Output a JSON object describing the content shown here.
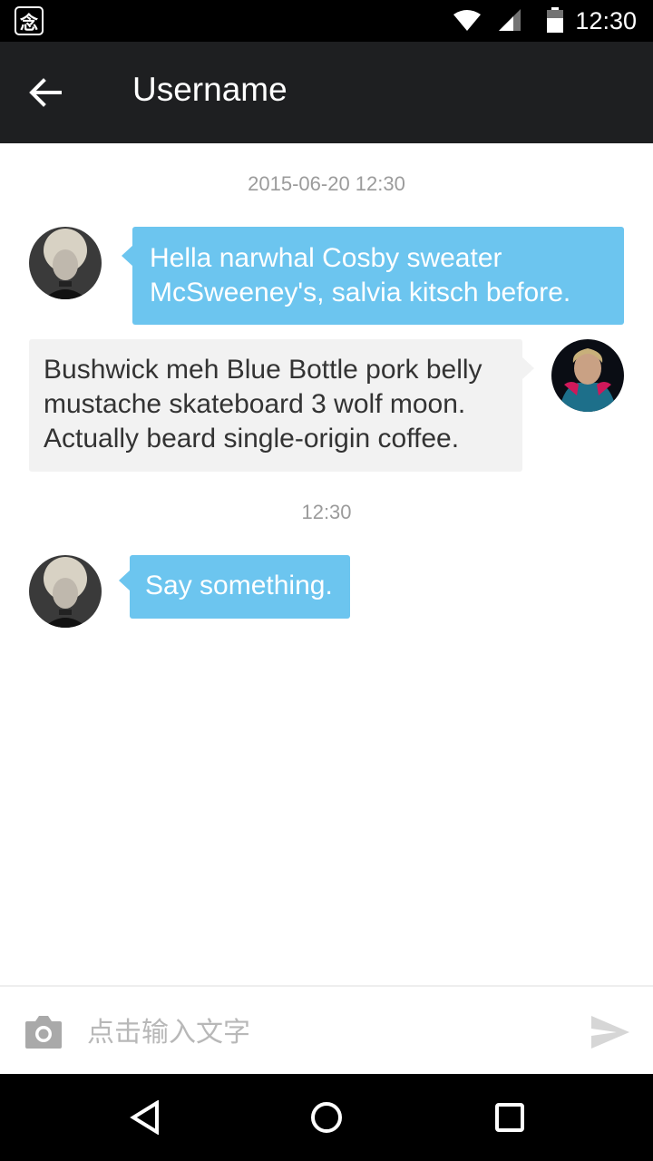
{
  "status_bar": {
    "app_badge": "念",
    "time": "12:30"
  },
  "toolbar": {
    "title": "Username"
  },
  "conversation": {
    "timestamp_1": "2015-06-20  12:30",
    "timestamp_2": "12:30",
    "messages": [
      {
        "sender": "contact",
        "text": "Hella narwhal Cosby sweater McSweeney's, salvia kitsch before."
      },
      {
        "sender": "me",
        "text": "Bushwick meh Blue Bottle pork belly mustache skateboard 3 wolf moon. Actually beard single-origin coffee."
      },
      {
        "sender": "contact",
        "text": "Say something."
      }
    ]
  },
  "input_bar": {
    "placeholder": "点击输入文字",
    "value": ""
  },
  "colors": {
    "toolbar_bg": "#1e1f21",
    "incoming_bubble": "#6cc5ef",
    "outgoing_bubble": "#f2f2f2"
  },
  "icons": {
    "back": "arrow-left-icon",
    "camera": "camera-icon",
    "send": "send-icon",
    "nav_back": "triangle-back-icon",
    "nav_home": "circle-home-icon",
    "nav_recents": "square-recents-icon"
  }
}
